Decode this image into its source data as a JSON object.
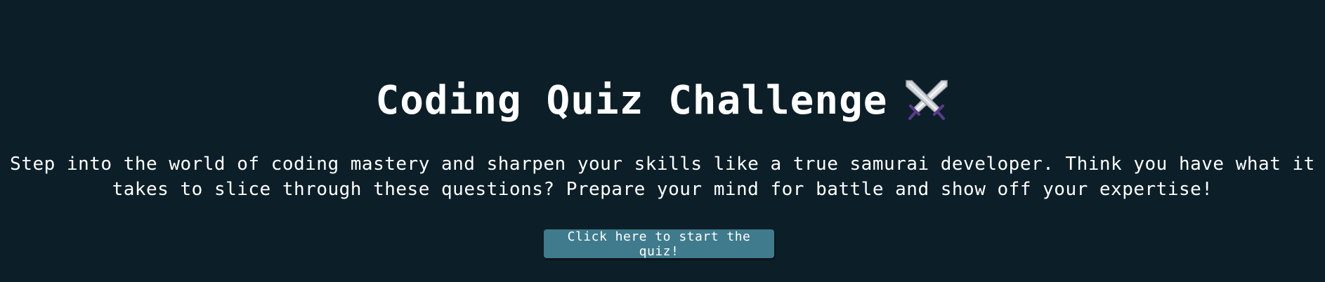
{
  "header": {
    "title": "Coding Quiz Challenge",
    "title_icon": "crossed-swords-icon"
  },
  "intro": {
    "line1": "Step into the world of coding mastery and sharpen your skills like a true samurai developer. Think you have what it",
    "line2": "takes to slice through these questions? Prepare your mind for battle and show off your expertise!"
  },
  "start": {
    "label": "Click here to start the quiz!"
  },
  "colors": {
    "background": "#0c1f28",
    "text": "#ffffff",
    "button": "#3f7b8c",
    "sword_hilt": "#5c3a8c"
  }
}
